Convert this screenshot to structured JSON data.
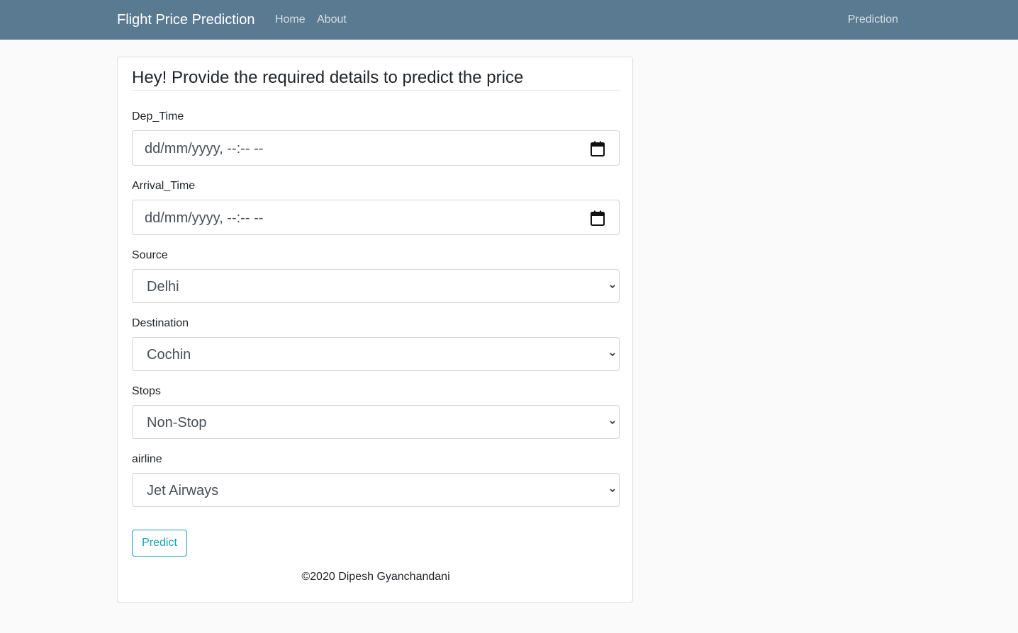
{
  "navbar": {
    "brand": "Flight Price Prediction",
    "links": [
      "Home",
      "About"
    ],
    "right_link": "Prediction"
  },
  "form": {
    "title": "Hey! Provide the required details to predict the price",
    "dep_time": {
      "label": "Dep_Time",
      "value": "dd/mm/yyyy, --:-- --"
    },
    "arrival_time": {
      "label": "Arrival_Time",
      "value": "dd/mm/yyyy, --:-- --"
    },
    "source": {
      "label": "Source",
      "selected": "Delhi"
    },
    "destination": {
      "label": "Destination",
      "selected": "Cochin"
    },
    "stops": {
      "label": "Stops",
      "selected": "Non-Stop"
    },
    "airline": {
      "label": "airline",
      "selected": "Jet Airways"
    },
    "submit_label": "Predict"
  },
  "footer": {
    "text": "©2020 Dipesh Gyanchandani"
  },
  "colors": {
    "navbar_bg": "#5a7a91",
    "button_accent": "#17a2b8",
    "page_bg": "#fafafa"
  },
  "icons": {
    "date_picker": "calendar-icon",
    "select": "chevron-down-icon"
  }
}
